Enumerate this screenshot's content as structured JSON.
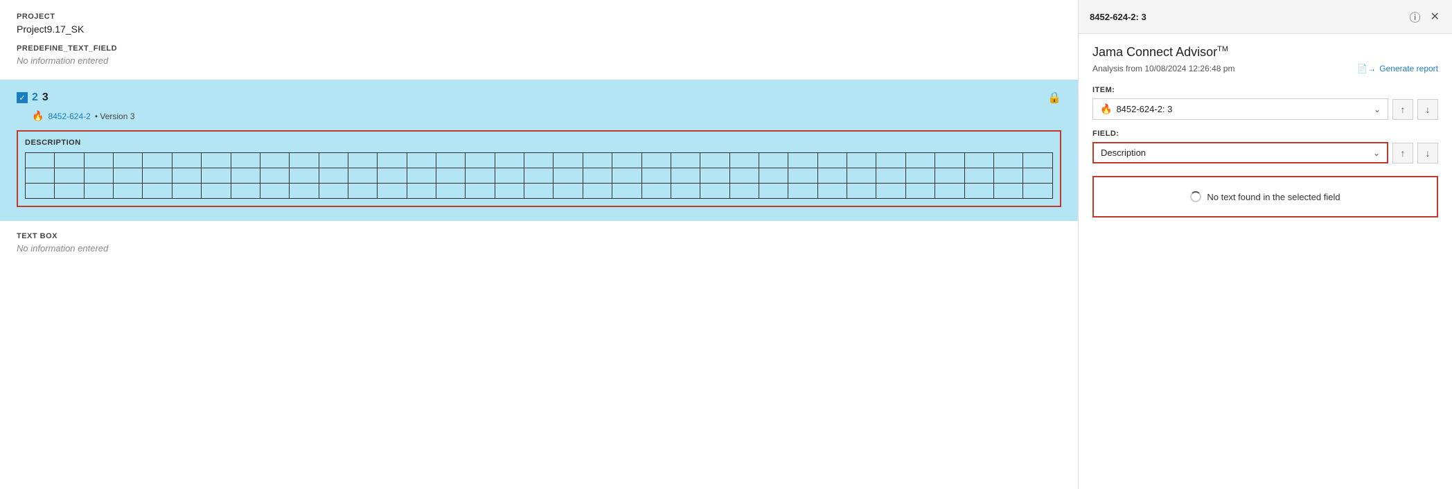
{
  "left": {
    "project_label": "PROJECT",
    "project_name": "Project9.17_SK",
    "predefine_label": "PREDEFINE_TEXT_FIELD",
    "predefine_empty": "No information entered",
    "item": {
      "number_blue": "2",
      "number_dark": "3",
      "id_link": "8452-624-2",
      "version": "• Version 3",
      "description_label": "DESCRIPTION",
      "grid_rows": 3,
      "grid_cols": 35
    },
    "textbox_label": "TEXT BOX",
    "textbox_empty": "No information entered"
  },
  "right": {
    "panel_title": "8452-624-2: 3",
    "advisor_title": "Jama Connect Advisor",
    "advisor_tm": "TM",
    "analysis_text": "Analysis from 10/08/2024 12:26:48 pm",
    "generate_report_label": "Generate report",
    "item_section_label": "ITEM:",
    "item_value": "8452-624-2: 3",
    "field_section_label": "FIELD:",
    "field_value": "Description",
    "no_text_message": "No text found in the selected field"
  }
}
